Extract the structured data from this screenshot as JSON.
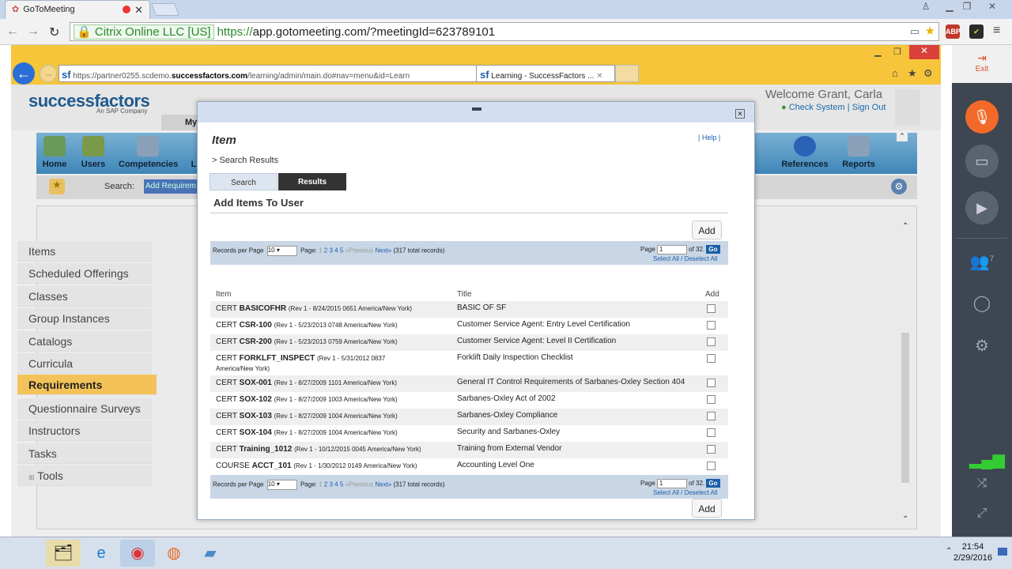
{
  "chrome": {
    "tab_title": "GoToMeeting",
    "cert": "Citrix Online LLC [US]",
    "url_https": "https://",
    "url_rest": "app.gotomeeting.com/?meetingId=623789101",
    "ext_abp": "ABP"
  },
  "gtm": {
    "exit": "Exit",
    "attendees": "7"
  },
  "ie": {
    "address_prefix": "https://partner0255.scdemo.",
    "address_host": "successfactors.com",
    "address_path": "/learning/admin/main.do#nav=menu&id=Learn",
    "tab": "Learning - SuccessFactors ..."
  },
  "sf": {
    "logo": "successfactors",
    "logo_sub": "An SAP Company",
    "welcome": "Welcome Grant, Carla",
    "check_system": "Check System",
    "sign_out": "Sign Out",
    "tab_my": "My",
    "nav": [
      {
        "label": "Home"
      },
      {
        "label": "Users"
      },
      {
        "label": "Competencies"
      },
      {
        "label": "L"
      },
      {
        "label": "References"
      },
      {
        "label": "Reports"
      }
    ],
    "search_label": "Search:",
    "search_value": "Add Requirem",
    "menu": [
      {
        "label": "Items"
      },
      {
        "label": "Scheduled Offerings"
      },
      {
        "label": "Classes"
      },
      {
        "label": "Group Instances"
      },
      {
        "label": "Catalogs"
      },
      {
        "label": "Curricula"
      },
      {
        "label": "Requirements"
      },
      {
        "label": "Questionnaire Surveys"
      },
      {
        "label": "Instructors"
      },
      {
        "label": "Tasks"
      },
      {
        "label": "Tools"
      }
    ]
  },
  "modal": {
    "title": "Item",
    "help": "Help",
    "breadcrumb": "> Search Results",
    "tab_search": "Search",
    "tab_results": "Results",
    "section": "Add Items To User",
    "add": "Add",
    "pager": {
      "records_per_page": "Records per Page",
      "rpp_value": "10",
      "page_label": "Page:",
      "pages": [
        "1",
        "2",
        "3",
        "4",
        "5"
      ],
      "previous": "«Previous",
      "next": "Next»",
      "total": "(317 total records)",
      "page": "Page",
      "page_value": "1",
      "of": "of 32.",
      "go": "Go",
      "select_all": "Select All / Deselect All"
    },
    "columns": {
      "item": "Item",
      "title": "Title",
      "add": "Add"
    },
    "rows": [
      {
        "type": "CERT",
        "id": "BASICOFHR",
        "rev": "(Rev 1 - 8/24/2015 0651 America/New York)",
        "title": "BASIC OF SF"
      },
      {
        "type": "CERT",
        "id": "CSR-100",
        "rev": "(Rev 1 - 5/23/2013 0748 America/New York)",
        "title": "Customer Service Agent: Entry Level Certification"
      },
      {
        "type": "CERT",
        "id": "CSR-200",
        "rev": "(Rev 1 - 5/23/2013 0759 America/New York)",
        "title": "Customer Service Agent: Level II Certification"
      },
      {
        "type": "CERT",
        "id": "FORKLFT_INSPECT",
        "rev": "(Rev 1 - 5/31/2012 0837 America/New York)",
        "title": "Forklift Daily Inspection Checklist"
      },
      {
        "type": "CERT",
        "id": "SOX-001",
        "rev": "(Rev 1 - 8/27/2009 1101 America/New York)",
        "title": "General IT Control Requirements of Sarbanes-Oxley Section 404"
      },
      {
        "type": "CERT",
        "id": "SOX-102",
        "rev": "(Rev 1 - 8/27/2009 1003 America/New York)",
        "title": "Sarbanes-Oxley Act of 2002"
      },
      {
        "type": "CERT",
        "id": "SOX-103",
        "rev": "(Rev 1 - 8/27/2009 1004 America/New York)",
        "title": "Sarbanes-Oxley Compliance"
      },
      {
        "type": "CERT",
        "id": "SOX-104",
        "rev": "(Rev 1 - 8/27/2009 1004 America/New York)",
        "title": "Security and Sarbanes-Oxley"
      },
      {
        "type": "CERT",
        "id": "Training_1012",
        "rev": "(Rev 1 - 10/12/2015 0045 America/New York)",
        "title": "Training from External Vendor"
      },
      {
        "type": "COURSE",
        "id": "ACCT_101",
        "rev": "(Rev 1 - 1/30/2012 0149 America/New York)",
        "title": "Accounting Level One"
      }
    ]
  },
  "taskbar": {
    "time": "21:54",
    "date": "2/29/2016"
  },
  "colors": {
    "accent": "#1a5ea8",
    "selected_menu": "#f3c35a",
    "ie_frame": "#f6c53a",
    "gtm_panel": "#3e4652",
    "gtm_mic": "#f26a2a"
  }
}
